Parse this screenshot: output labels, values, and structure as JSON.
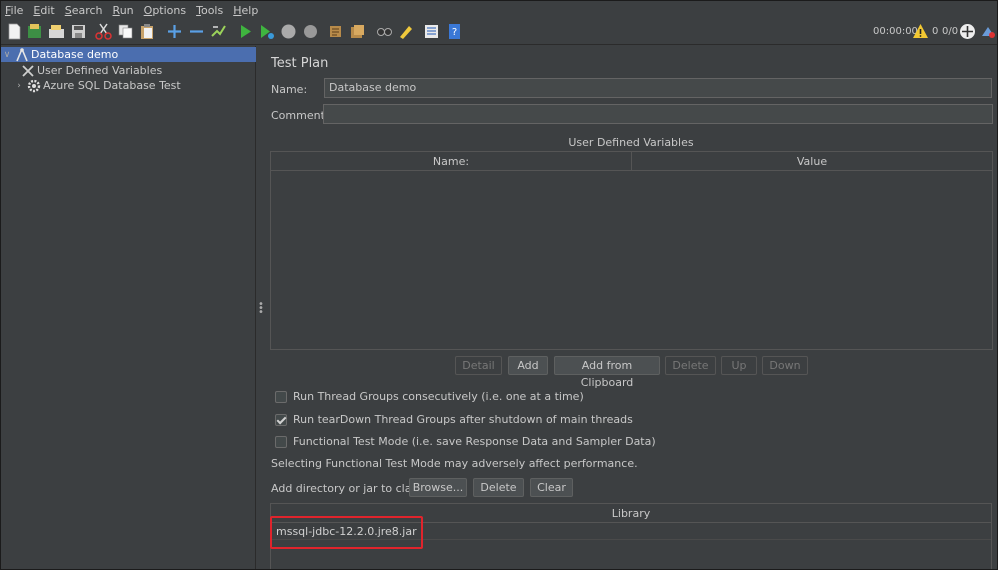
{
  "menu": {
    "file": {
      "u": "F",
      "rest": "ile"
    },
    "edit": {
      "u": "E",
      "rest": "dit"
    },
    "search": {
      "u": "S",
      "rest": "earch"
    },
    "run": {
      "u": "R",
      "rest": "un"
    },
    "options": {
      "u": "O",
      "rest": "ptions"
    },
    "tools": {
      "u": "T",
      "rest": "ools"
    },
    "help": {
      "u": "H",
      "rest": "elp"
    }
  },
  "toolbar": {
    "elapsed_time": "00:00:00",
    "warning_count": "0",
    "threads_ratio": "0/0"
  },
  "tree": {
    "root_label": "Database demo",
    "child1_label": "User Defined Variables",
    "child2_label": "Azure SQL Database Test"
  },
  "test_plan": {
    "title": "Test Plan",
    "name_label": "Name:",
    "name_value": "Database demo",
    "comments_label": "Comments:",
    "comments_value": "",
    "udv_section_title": "User Defined Variables",
    "udv_columns": [
      "Name:",
      "Value"
    ],
    "buttons": {
      "detail": "Detail",
      "add": "Add",
      "add_from_clipboard": "Add from Clipboard",
      "delete": "Delete",
      "up": "Up",
      "down": "Down"
    },
    "options": {
      "run_consecutively": "Run Thread Groups consecutively (i.e. one at a time)",
      "run_teardown": "Run tearDown Thread Groups after shutdown of main threads",
      "functional_mode": "Functional Test Mode (i.e. save Response Data and Sampler Data)",
      "functional_warning": "Selecting Functional Test Mode may adversely affect performance."
    },
    "checked": {
      "run_consecutively": false,
      "run_teardown": true,
      "functional_mode": false
    },
    "classpath_label": "Add directory or jar to classpath",
    "classpath_buttons": {
      "browse": "Browse...",
      "delete": "Delete",
      "clear": "Clear"
    },
    "library_header": "Library",
    "libraries": [
      "mssql-jdbc-12.2.0.jre8.jar"
    ]
  },
  "colors": {
    "background": "#3c3f41",
    "selection": "#4b6eaf",
    "highlight_box": "#e0242c",
    "run_green": "#3fb53f"
  }
}
